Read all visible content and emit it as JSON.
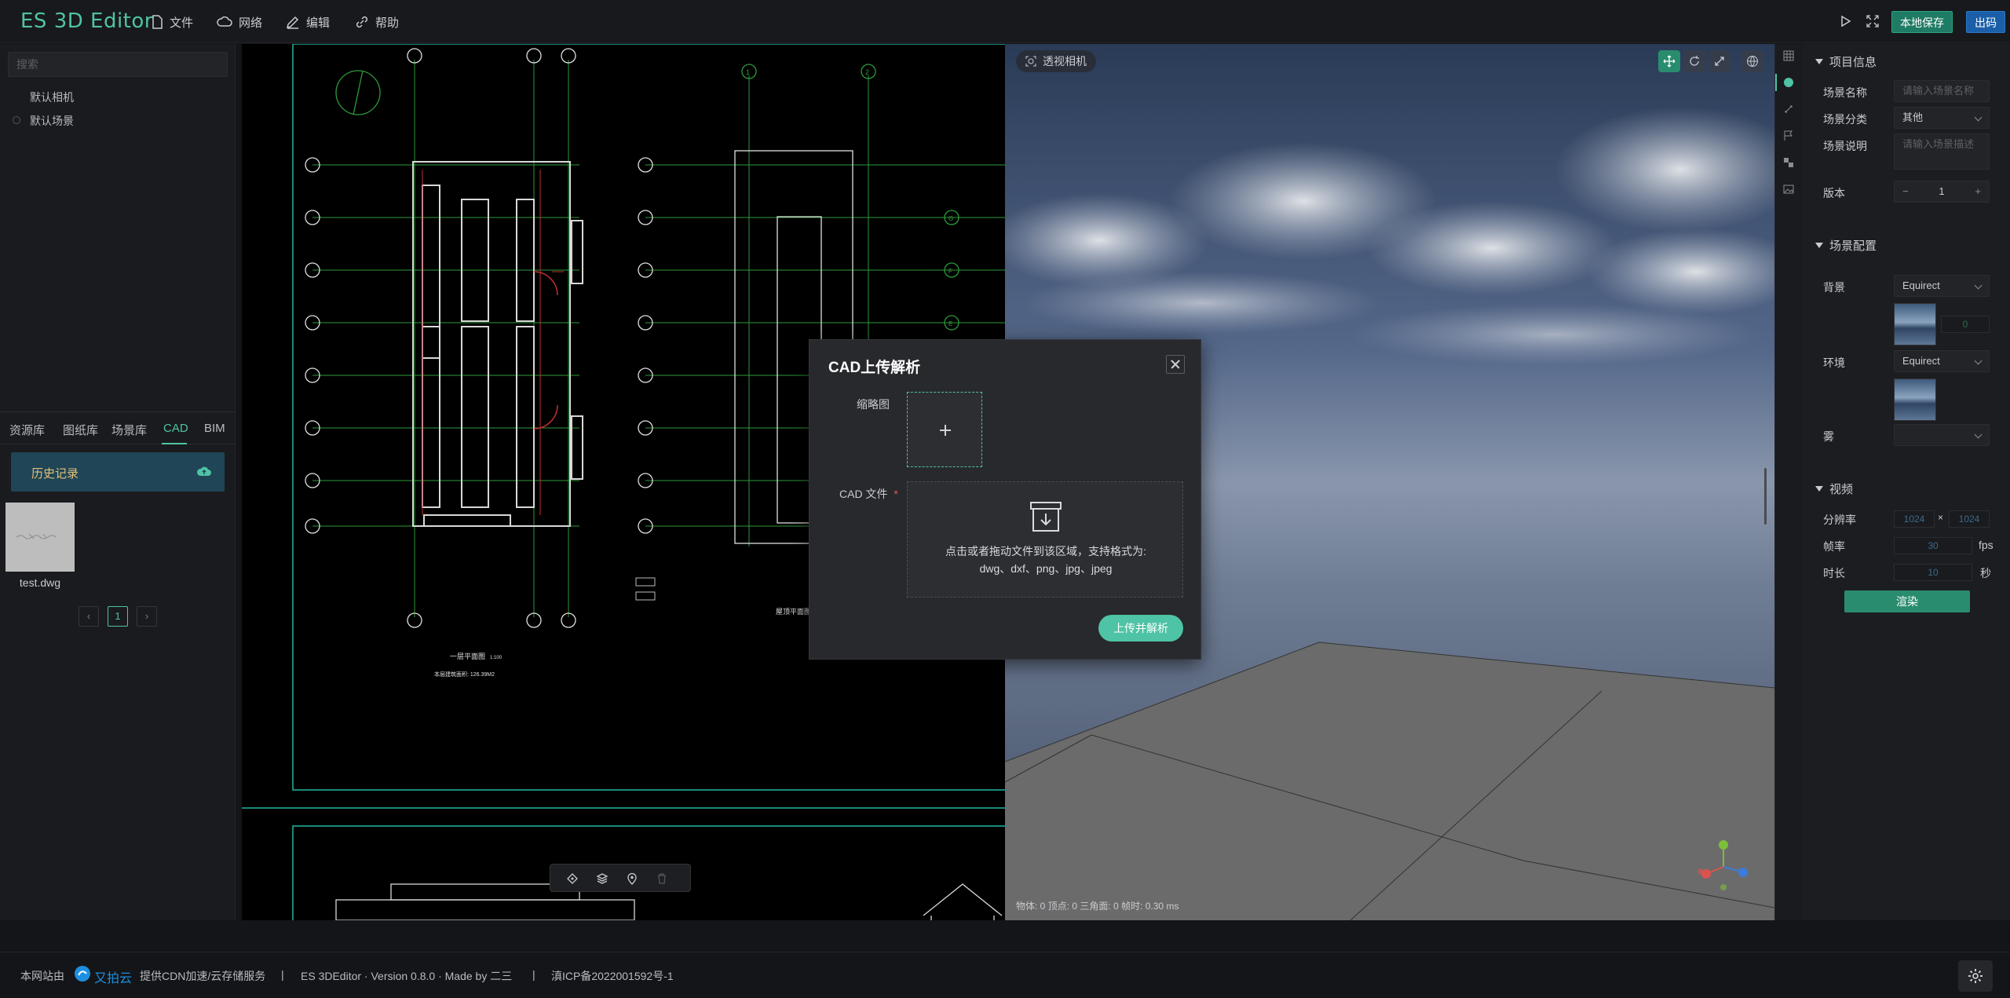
{
  "app": {
    "title": "ES 3D Editor",
    "menu": [
      {
        "label": "文件",
        "icon": "file-icon"
      },
      {
        "label": "网络",
        "icon": "cloud-icon"
      },
      {
        "label": "编辑",
        "icon": "edit-icon"
      },
      {
        "label": "帮助",
        "icon": "link-icon"
      }
    ],
    "actions": {
      "save": "本地保存",
      "publish": "出码"
    }
  },
  "left_panel": {
    "search_placeholder": "搜索",
    "tree": [
      "默认相机",
      "默认场景"
    ],
    "tabs": [
      "资源库",
      "图纸库",
      "场景库",
      "CAD",
      "BIM"
    ],
    "active_tab": "CAD",
    "history_label": "历史记录",
    "files": [
      {
        "name": "test.dwg"
      }
    ],
    "pager": {
      "current": "1"
    }
  },
  "cad_drawing": {
    "axis_numbers": [
      "1",
      "2"
    ],
    "axis_letters": [
      "G",
      "F",
      "E"
    ],
    "title": "一层平面图",
    "scale": "1:100",
    "area_note": "本层建筑面积: 126.39M2",
    "roof_title": "屋顶平面图"
  },
  "viewport": {
    "camera_label": "透视相机",
    "stats": "物体: 0  顶点: 0  三角面: 0  帧时: 0.30 ms"
  },
  "right_panel": {
    "project_info": {
      "title": "项目信息",
      "name_label": "场景名称",
      "name_placeholder": "请输入场景名称",
      "category_label": "场景分类",
      "category_value": "其他",
      "desc_label": "场景说明",
      "desc_placeholder": "请输入场景描述",
      "version_label": "版本",
      "version_value": "1"
    },
    "scene_config": {
      "title": "场景配置",
      "background_label": "背景",
      "background_value": "Equirect",
      "background_extra": "0",
      "environment_label": "环境",
      "environment_value": "Equirect",
      "fog_label": "雾"
    },
    "video": {
      "title": "视频",
      "resolution_label": "分辨率",
      "width": "1024",
      "height": "1024",
      "times": "×",
      "fps_label": "帧率",
      "fps": "30",
      "fps_unit": "fps",
      "duration_label": "时长",
      "duration": "10",
      "duration_unit": "秒",
      "render_label": "渲染"
    }
  },
  "footer": {
    "hosted_by": "本网站由",
    "cdn_brand": "又拍云",
    "cdn_text": "提供CDN加速/云存储服务",
    "sep": "|",
    "version": "ES 3DEditor · Version 0.8.0 · Made by 二三",
    "icp": "滇ICP备2022001592号-1"
  },
  "modal": {
    "title": "CAD上传解析",
    "thumb_label": "缩略图",
    "file_label": "CAD 文件",
    "required_mark": "*",
    "drop_text": "点击或者拖动文件到该区域，支持格式为:",
    "drop_formats": "dwg、dxf、png、jpg、jpeg",
    "submit_label": "上传并解析"
  },
  "colors": {
    "accent": "#4fc3a5",
    "publish": "#1b5fa8",
    "save": "#1e7b64"
  }
}
